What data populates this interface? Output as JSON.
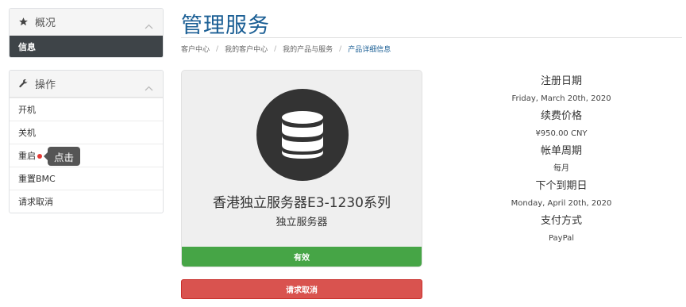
{
  "sidebar": {
    "overview": {
      "title": "概况",
      "icon": "star-icon",
      "active_item": "信息"
    },
    "actions": {
      "title": "操作",
      "icon": "wrench-icon",
      "items": [
        "开机",
        "关机",
        "重启",
        "重置BMC",
        "请求取消"
      ]
    },
    "tooltip": "点击"
  },
  "page": {
    "title": "管理服务",
    "breadcrumb": [
      "客户中心",
      "我的客户中心",
      "我的产品与服务",
      "产品详细信息"
    ]
  },
  "product": {
    "icon": "database-icon",
    "name": "香港独立服务器E3-1230系列",
    "type": "独立服务器",
    "status": "有效"
  },
  "cancel_button": "请求取消",
  "details": {
    "reg_date_label": "注册日期",
    "reg_date": "Friday, March 20th, 2020",
    "price_label": "续费价格",
    "price": "¥950.00 CNY",
    "cycle_label": "帐单周期",
    "cycle": "每月",
    "due_label": "下个到期日",
    "due": "Monday, April 20th, 2020",
    "pay_label": "支付方式",
    "pay": "PayPal"
  },
  "colors": {
    "title": "#1a5e94",
    "active": "#3e4448",
    "status_green": "#46a546",
    "cancel_red": "#d9534f"
  }
}
